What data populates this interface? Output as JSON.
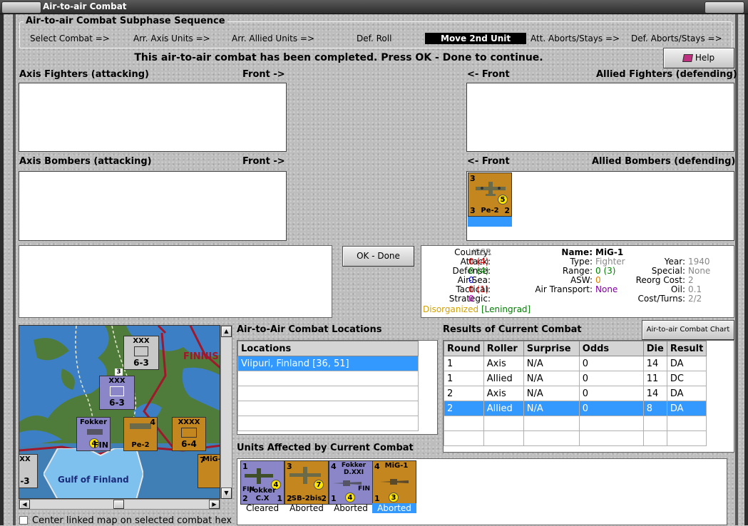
{
  "window": {
    "title": "Air-to-air Combat",
    "left_btn": "",
    "right_btn": ""
  },
  "subphase": {
    "header": "Air-to-air Combat Subphase Sequence",
    "steps": [
      "Select Combat =>",
      "Arr. Axis Units =>",
      "Arr. Allied Units =>",
      "Def. Roll",
      "Move 2nd Unit",
      "Att. Aborts/Stays =>",
      "Def. Aborts/Stays =>"
    ]
  },
  "message": "This air-to-air combat has been completed.  Press OK - Done to continue.",
  "help_label": "Help",
  "panels": {
    "axis_fighters": "Axis Fighters (attacking)",
    "axis_fighters_front": "Front ->",
    "allied_fighters": "Allied Fighters (defending)",
    "allied_fighters_front": "<- Front",
    "axis_bombers": "Axis Bombers (attacking)",
    "axis_bombers_front": "Front ->",
    "allied_bombers": "Allied Bombers (defending)",
    "allied_bombers_front": "<- Front"
  },
  "allied_bomber_unit": {
    "name": "Pe-2",
    "top_left": "3",
    "bottom_left": "3",
    "bottom_right": "2",
    "disc": "5"
  },
  "ok_button": "OK - Done",
  "unit_info": {
    "country_label": "Country:",
    "country": "USSR",
    "attack_label": "Attack:",
    "attack": "0 (4)",
    "defense_label": "Defense:",
    "defense": "0 (4)",
    "airsea_label": "Air-Sea:",
    "airsea": "0",
    "asw_label": "ASW:",
    "asw": "0",
    "tactical_label": "Tactical:",
    "tactical": "0 (1)",
    "strategic_label": "Strategic:",
    "strategic": "0",
    "status": "Disorganized",
    "location": "[Leningrad]",
    "name_label": "Name:",
    "name": "MiG-1",
    "type_label": "Type:",
    "type": "Fighter",
    "range_label": "Range:",
    "range": "0 (3)",
    "airtransport_label": "Air Transport:",
    "airtransport": "None",
    "year_label": "Year:",
    "year": "1940",
    "special_label": "Special:",
    "special": "None",
    "reorg_label": "Reorg Cost:",
    "reorg": "2",
    "oil_label": "Oil:",
    "oil": "0.1",
    "cost_label": "Cost/Turns:",
    "cost": "2/2"
  },
  "map": {
    "label_finnish": "FINNIS",
    "gulf": "Gulf of Finland",
    "units": [
      {
        "top": "XXX",
        "val": "6-3",
        "corner": "3"
      },
      {
        "top": "XXX",
        "val": "6-3",
        "corner": "3"
      },
      {
        "top": "XXXX",
        "val": "6-4",
        "corner": ""
      },
      {
        "top": "Fokker",
        "val": "FIN",
        "corner": "4"
      },
      {
        "top": "",
        "val": "Pe-2",
        "corner": "4"
      },
      {
        "top": "MiG-",
        "val": "",
        "corner": "7"
      },
      {
        "top": "XX",
        "val": "-3",
        "corner": ""
      }
    ],
    "center_label": "Center linked map on selected combat hex"
  },
  "locations": {
    "title": "Air-to-Air Combat Locations",
    "header": "Locations",
    "rows": [
      "Viipuri, Finland [36, 51]"
    ]
  },
  "results": {
    "title": "Results of Current Combat",
    "chart_button": "Air-to-air Combat Chart",
    "columns": [
      "Round",
      "Roller",
      "Surprise",
      "Odds",
      "Die",
      "Result"
    ],
    "rows": [
      [
        "1",
        "Axis",
        "N/A",
        "0",
        "14",
        "DA"
      ],
      [
        "1",
        "Allied",
        "N/A",
        "0",
        "11",
        "DC"
      ],
      [
        "2",
        "Axis",
        "N/A",
        "0",
        "14",
        "DA"
      ],
      [
        "2",
        "Allied",
        "N/A",
        "0",
        "8",
        "DA"
      ]
    ]
  },
  "affected": {
    "title": "Units Affected by Current Combat",
    "units": [
      {
        "name": "Fokker C.X",
        "tl": "1",
        "bl": "2",
        "br": "1",
        "disc": "4",
        "status": "Cleared",
        "top": "",
        "side": "FIN"
      },
      {
        "name": "SB-2bis",
        "tl": "3",
        "bl": "2",
        "br": "2",
        "disc": "7",
        "status": "Aborted",
        "top": "",
        "side": ""
      },
      {
        "name": "",
        "tl": "4",
        "bl": "1",
        "br": "",
        "disc": "4",
        "status": "Aborted",
        "top": "Fokker D.XXI",
        "side": "FIN"
      },
      {
        "name": "",
        "tl": "4",
        "bl": "1",
        "br": "",
        "disc": "3",
        "status": "Aborted",
        "top": "MiG-1",
        "side": ""
      }
    ]
  },
  "colors": {
    "axis_counter": "#8a86c8",
    "soviet_counter": "#c4861e",
    "finnish_counter": "#8a86c8",
    "selection": "#3399ff",
    "sea": "#3d7fc4",
    "land": "#4f7c3a"
  }
}
